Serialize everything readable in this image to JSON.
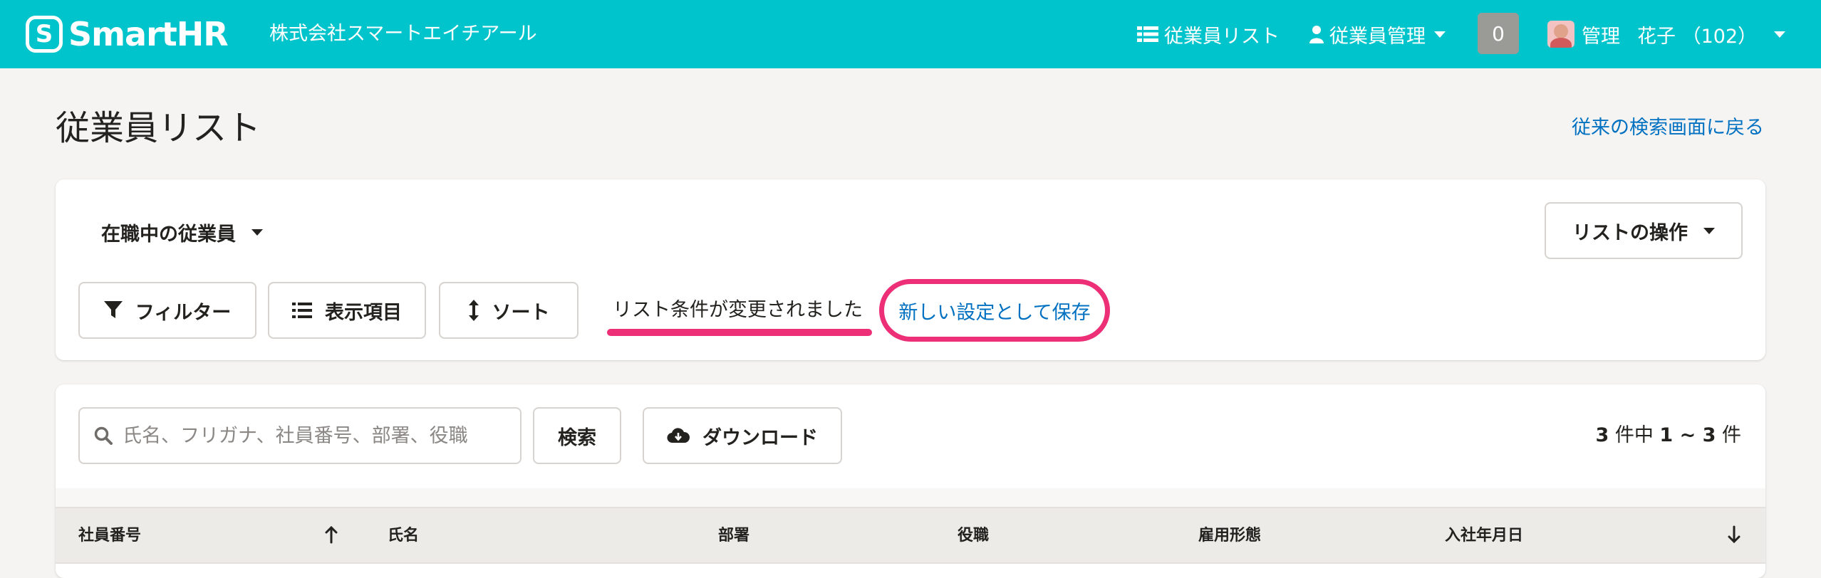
{
  "header": {
    "logo_text": "SmartHR",
    "company": "株式会社スマートエイチアール",
    "nav_list": "従業員リスト",
    "nav_mgmt": "従業員管理",
    "notification_count": "0",
    "user_name_1": "管理",
    "user_name_2": "花子 （102）"
  },
  "page": {
    "title": "従業員リスト",
    "back_link": "従来の検索画面に戻る"
  },
  "list_panel": {
    "current_list": "在職中の従業員",
    "list_ops": "リストの操作",
    "filter": "フィルター",
    "columns": "表示項目",
    "sort": "ソート",
    "changed_message": "リスト条件が変更されました",
    "save_link": "新しい設定として保存"
  },
  "results_panel": {
    "search_placeholder": "氏名、フリガナ、社員番号、部署、役職",
    "search_button": "検索",
    "download_button": "ダウンロード",
    "count_total": "3",
    "count_mid": " 件中 ",
    "count_range": "1 ~ 3",
    "count_suffix": " 件"
  },
  "table": {
    "columns": [
      "社員番号",
      "氏名",
      "部署",
      "役職",
      "雇用形態",
      "入社年月日"
    ]
  },
  "colors": {
    "brand": "#00c4cc",
    "link": "#0071c1",
    "highlight": "#ec2f77"
  }
}
